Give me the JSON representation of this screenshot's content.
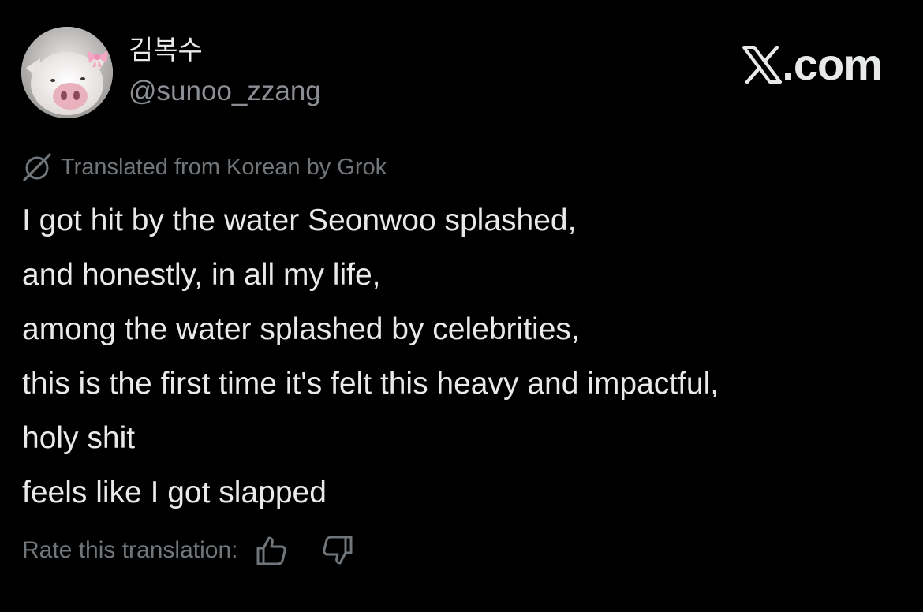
{
  "tweet": {
    "author": {
      "display_name": "김복수",
      "handle": "@sunoo_zzang",
      "avatar_icon": "pig-with-pink-bow-avatar"
    },
    "brand": {
      "label": ".com",
      "icon": "x-logo-icon"
    },
    "translation_note": {
      "icon": "grok-icon",
      "text": "Translated from Korean by Grok"
    },
    "body_lines": [
      "I got hit by the water Seonwoo splashed,",
      "and honestly, in all my life,",
      "among the water splashed by celebrities,",
      "this is the first time it's felt this heavy and impactful,",
      "holy shit",
      "feels like I got slapped"
    ],
    "rating": {
      "label": "Rate this translation:",
      "up_icon": "thumbs-up-icon",
      "down_icon": "thumbs-down-icon"
    }
  },
  "colors": {
    "background": "#000000",
    "primary_text": "#e7e9ea",
    "secondary_text": "#71767b",
    "bow_pink": "#f4a6c4"
  }
}
